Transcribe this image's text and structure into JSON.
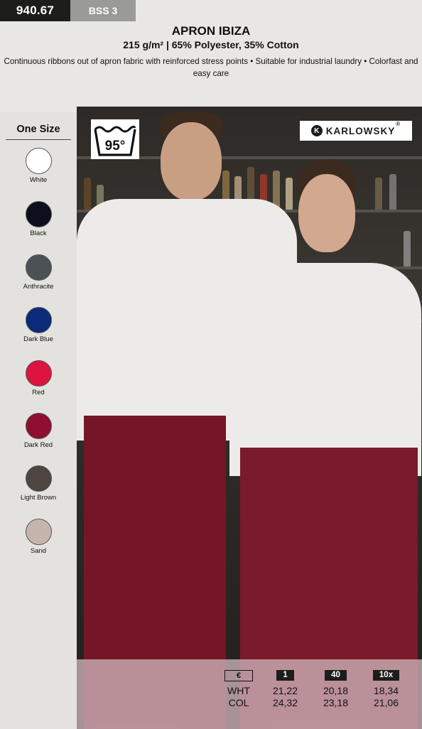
{
  "tag": {
    "code": "940.67",
    "category": "BSS 3"
  },
  "header": {
    "title": "APRON IBIZA",
    "subtitle": "215 g/m² | 65% Polyester, 35% Cotton",
    "description": "Continuous ribbons out of apron fabric with reinforced stress points • Suitable for industrial laundry • Colorfast and easy care"
  },
  "sizes": {
    "label": "One Size"
  },
  "colors": [
    {
      "name": "White",
      "hex": "#ffffff"
    },
    {
      "name": "Black",
      "hex": "#0e0f1d"
    },
    {
      "name": "Anthracite",
      "hex": "#4b5256"
    },
    {
      "name": "Dark Blue",
      "hex": "#0b2a78"
    },
    {
      "name": "Red",
      "hex": "#dd1340"
    },
    {
      "name": "Dark Red",
      "hex": "#8e0f30"
    },
    {
      "name": "Light Brown",
      "hex": "#4e4440"
    },
    {
      "name": "Sand",
      "hex": "#c7b5ad"
    }
  ],
  "care": {
    "wash_temp": "95°"
  },
  "brand": {
    "name": "KARLOWSKY",
    "registered": "®"
  },
  "pricing": {
    "currency": "€",
    "headers": [
      "1",
      "40",
      "10x"
    ],
    "rows": [
      {
        "label": "WHT",
        "values": [
          "21,22",
          "20,18",
          "18,34"
        ]
      },
      {
        "label": "COL",
        "values": [
          "24,32",
          "23,18",
          "21,06"
        ]
      }
    ]
  }
}
